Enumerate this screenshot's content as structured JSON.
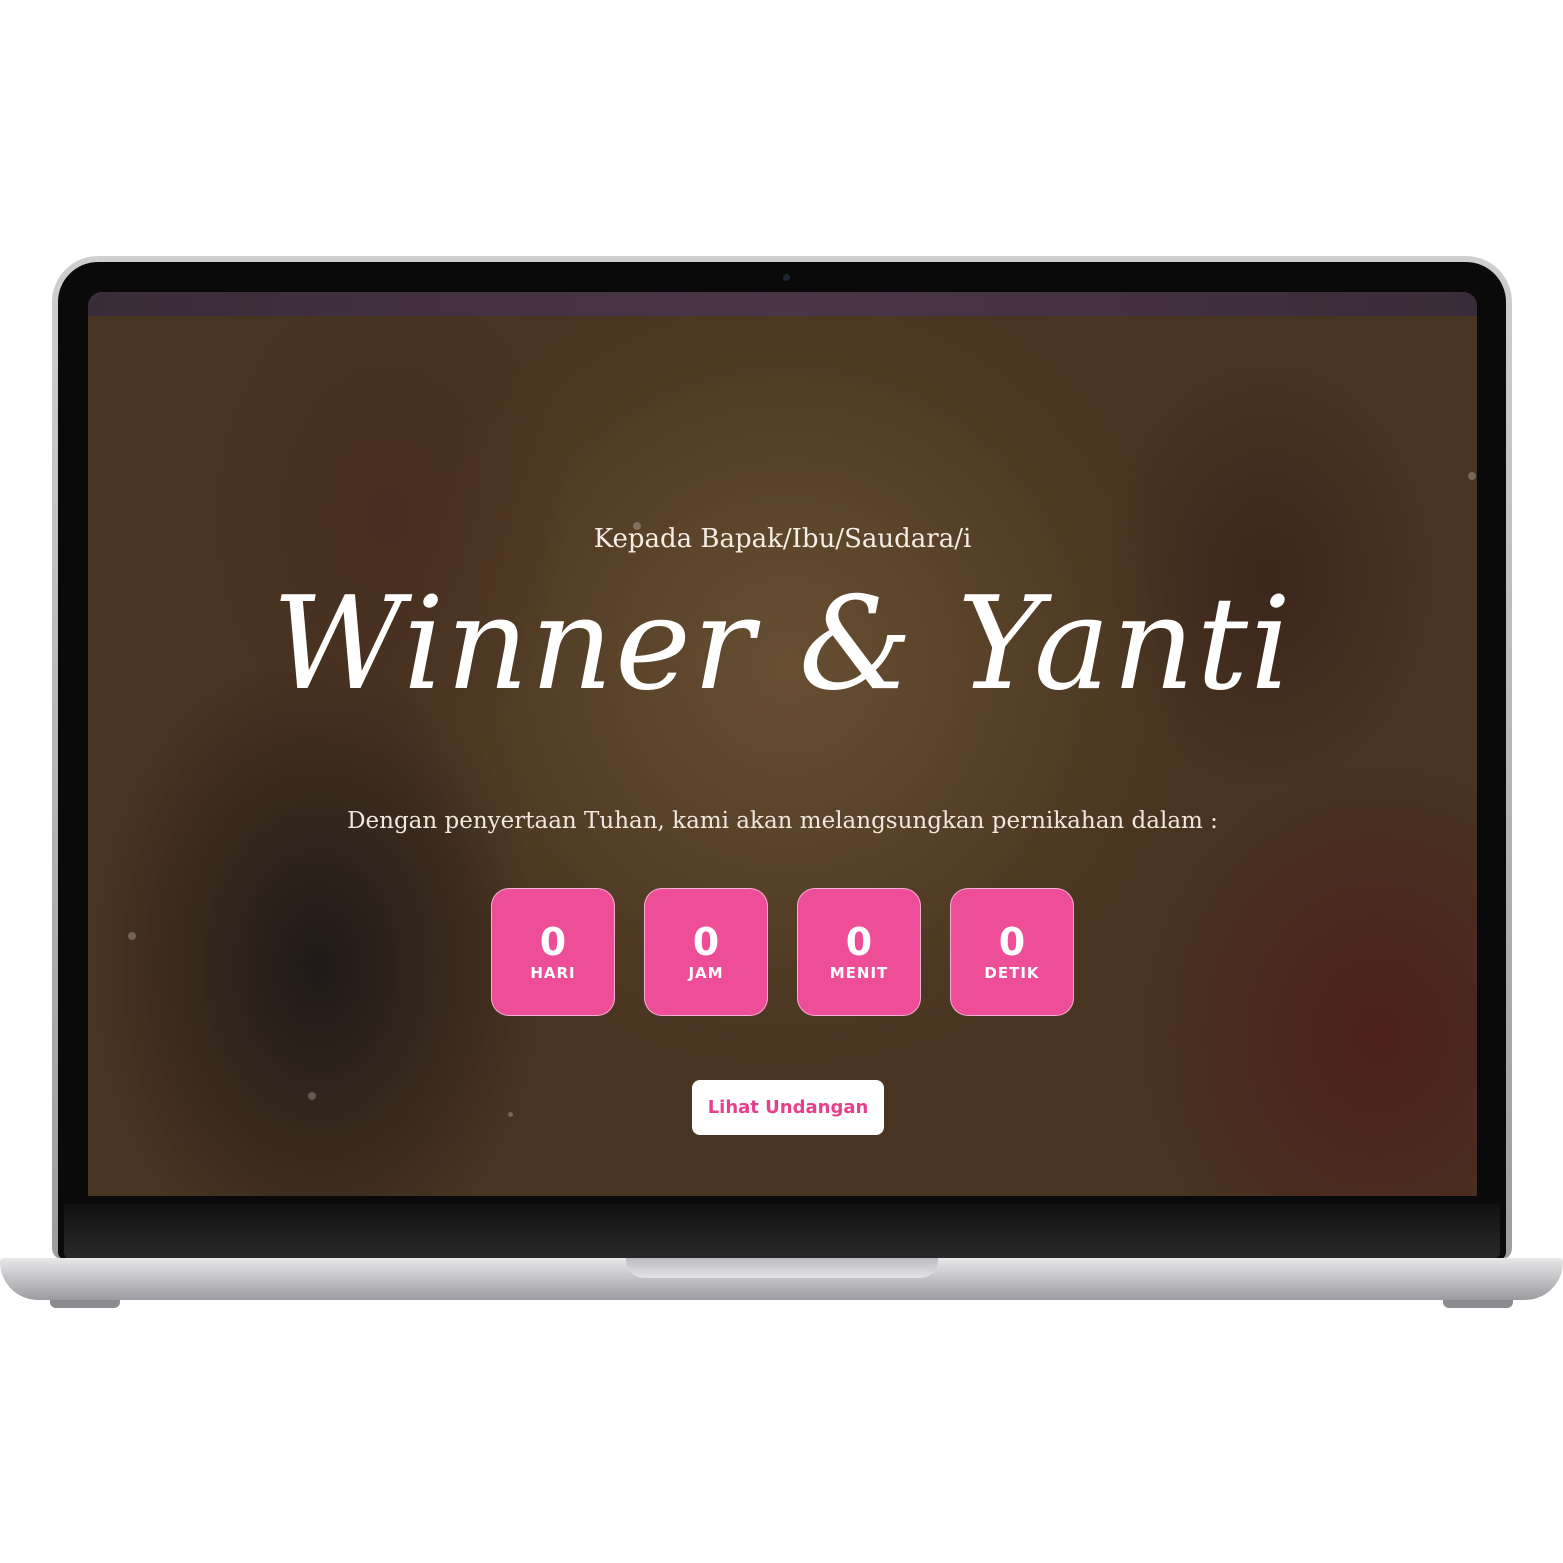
{
  "invitation": {
    "greeting": "Kepada Bapak/Ibu/Saudara/i",
    "couple_names": "Winner & Yanti",
    "intro_text": "Dengan penyertaan Tuhan, kami akan melangsungkan pernikahan dalam :",
    "countdown": [
      {
        "value": "0",
        "label": "HARI"
      },
      {
        "value": "0",
        "label": "JAM"
      },
      {
        "value": "0",
        "label": "MENIT"
      },
      {
        "value": "0",
        "label": "DETIK"
      }
    ],
    "open_button_label": "Lihat Undangan"
  },
  "colors": {
    "accent_pink": "#ee4d97",
    "button_text_pink": "#e83f8c",
    "text_white": "#ffffff"
  }
}
